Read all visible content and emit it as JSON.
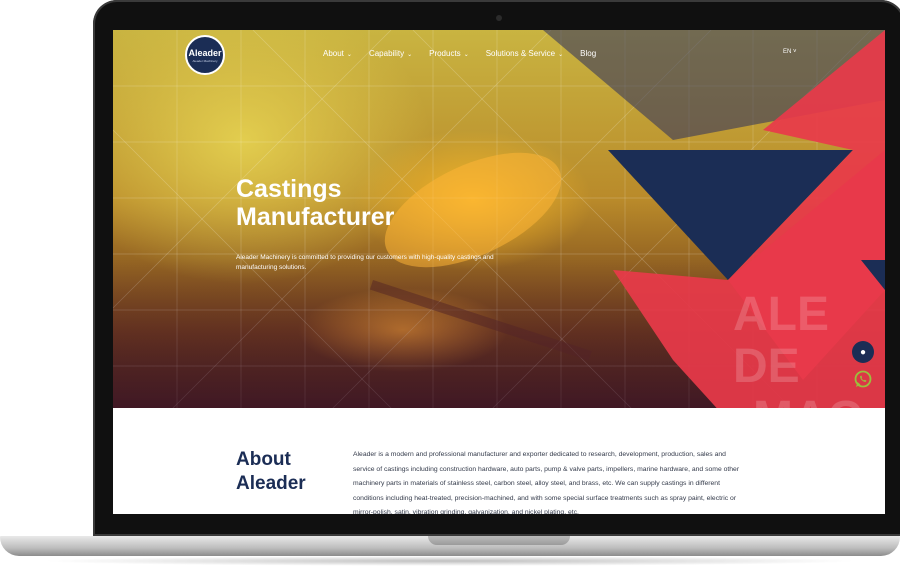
{
  "nav": {
    "logo_word": "Aleader",
    "logo_sub": "Aleader Machinery",
    "items": [
      {
        "label": "About",
        "chevron": "chevron-down-icon"
      },
      {
        "label": "Capability",
        "chevron": "chevron-down-icon"
      },
      {
        "label": "Products",
        "chevron": "chevron-down-icon"
      },
      {
        "label": "Solutions & Service",
        "chevron": "chevron-down-icon"
      },
      {
        "label": "Blog"
      }
    ],
    "language": "EN ˅"
  },
  "hero": {
    "title_line1": "Castings",
    "title_line2": "Manufacturer",
    "description": "Aleader Machinery is committed to providing our customers with high-quality castings and manufacturing solutions.",
    "watermark": [
      "ALE",
      "DE",
      "MAC"
    ]
  },
  "about": {
    "title_line1": "About",
    "title_line2": "Aleader",
    "text": "Aleader is a modern and professional manufacturer and exporter dedicated to research, development, production, sales and service of castings including construction hardware, auto parts, pump & valve parts, impellers, marine hardware, and some other machinery parts in materials of stainless steel, carbon steel, alloy steel, and brass, etc. We can supply castings in different conditions including heat-treated, precision-machined, and with some special surface treatments such as spray paint, electric or mirror-polish, satin, vibration grinding, galvanization, and nickel plating, etc."
  },
  "widgets": {
    "chat_icon": "chat-bubble-icon",
    "whatsapp_icon": "whatsapp-icon"
  },
  "colors": {
    "navy": "#1b2d55",
    "red": "#e8394a",
    "accent_green": "#9bbf3c"
  }
}
